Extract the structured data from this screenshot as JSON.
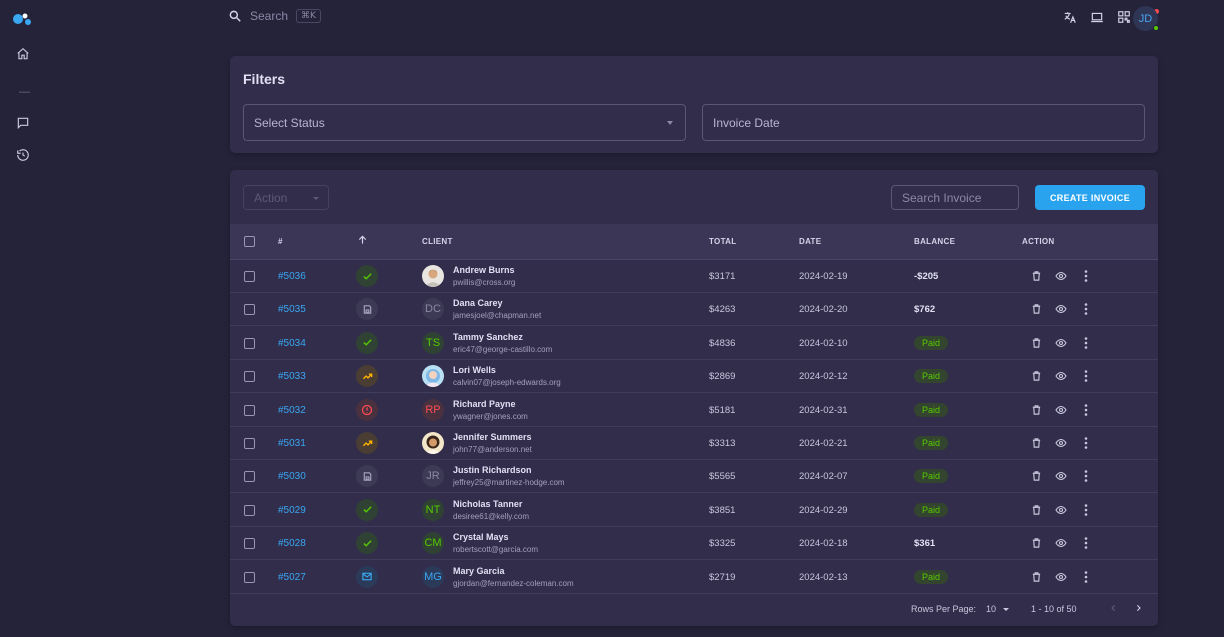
{
  "topbar": {
    "search_placeholder": "Search",
    "search_shortcut": "⌘K",
    "user_initials": "JD"
  },
  "filters": {
    "title": "Filters",
    "status_placeholder": "Select Status",
    "date_placeholder": "Invoice Date"
  },
  "toolbar": {
    "action_label": "Action",
    "search_placeholder": "Search Invoice",
    "create_label": "CREATE INVOICE"
  },
  "table": {
    "headers": {
      "id": "#",
      "client": "CLIENT",
      "total": "TOTAL",
      "date": "DATE",
      "balance": "BALANCE",
      "action": "ACTION"
    },
    "rows": [
      {
        "id": "#5036",
        "status": "paid",
        "avatar": "photo-man",
        "initials": "",
        "name": "Andrew Burns",
        "email": "pwillis@cross.org",
        "total": "$3171",
        "date": "2024-02-19",
        "balance": "-$205"
      },
      {
        "id": "#5035",
        "status": "draft",
        "avatar": "initials",
        "initials": "DC",
        "name": "Dana Carey",
        "email": "jamesjoel@chapman.net",
        "total": "$4263",
        "date": "2024-02-20",
        "balance": "$762"
      },
      {
        "id": "#5034",
        "status": "paid",
        "avatar": "initials",
        "initials": "TS",
        "name": "Tammy Sanchez",
        "email": "eric47@george-castillo.com",
        "total": "$4836",
        "date": "2024-02-10",
        "balance": "Paid"
      },
      {
        "id": "#5033",
        "status": "partial",
        "avatar": "photo-woman",
        "initials": "",
        "name": "Lori Wells",
        "email": "calvin07@joseph-edwards.org",
        "total": "$2869",
        "date": "2024-02-12",
        "balance": "Paid"
      },
      {
        "id": "#5032",
        "status": "past-due",
        "avatar": "initials",
        "initials": "RP",
        "name": "Richard Payne",
        "email": "ywagner@jones.com",
        "total": "$5181",
        "date": "2024-02-31",
        "balance": "Paid"
      },
      {
        "id": "#5031",
        "status": "partial",
        "avatar": "photo-woman-2",
        "initials": "",
        "name": "Jennifer Summers",
        "email": "john77@anderson.net",
        "total": "$3313",
        "date": "2024-02-21",
        "balance": "Paid"
      },
      {
        "id": "#5030",
        "status": "draft",
        "avatar": "initials",
        "initials": "JR",
        "name": "Justin Richardson",
        "email": "jeffrey25@martinez-hodge.com",
        "total": "$5565",
        "date": "2024-02-07",
        "balance": "Paid"
      },
      {
        "id": "#5029",
        "status": "paid",
        "avatar": "initials",
        "initials": "NT",
        "name": "Nicholas Tanner",
        "email": "desiree61@kelly.com",
        "total": "$3851",
        "date": "2024-02-29",
        "balance": "Paid"
      },
      {
        "id": "#5028",
        "status": "paid",
        "avatar": "initials",
        "initials": "CM",
        "name": "Crystal Mays",
        "email": "robertscott@garcia.com",
        "total": "$3325",
        "date": "2024-02-18",
        "balance": "$361"
      },
      {
        "id": "#5027",
        "status": "sent",
        "avatar": "initials",
        "initials": "MG",
        "name": "Mary Garcia",
        "email": "gjordan@fernandez-coleman.com",
        "total": "$2719",
        "date": "2024-02-13",
        "balance": "Paid"
      }
    ]
  },
  "pagination": {
    "rows_per_page_label": "Rows Per Page:",
    "rows_per_page": "10",
    "range": "1 - 10 of 50"
  },
  "colors": {
    "accent": "#29a3ee",
    "success": "#56ca00",
    "warning": "#ffb400",
    "error": "#ff4c51",
    "background": "#25233a",
    "card": "#312d4b"
  }
}
